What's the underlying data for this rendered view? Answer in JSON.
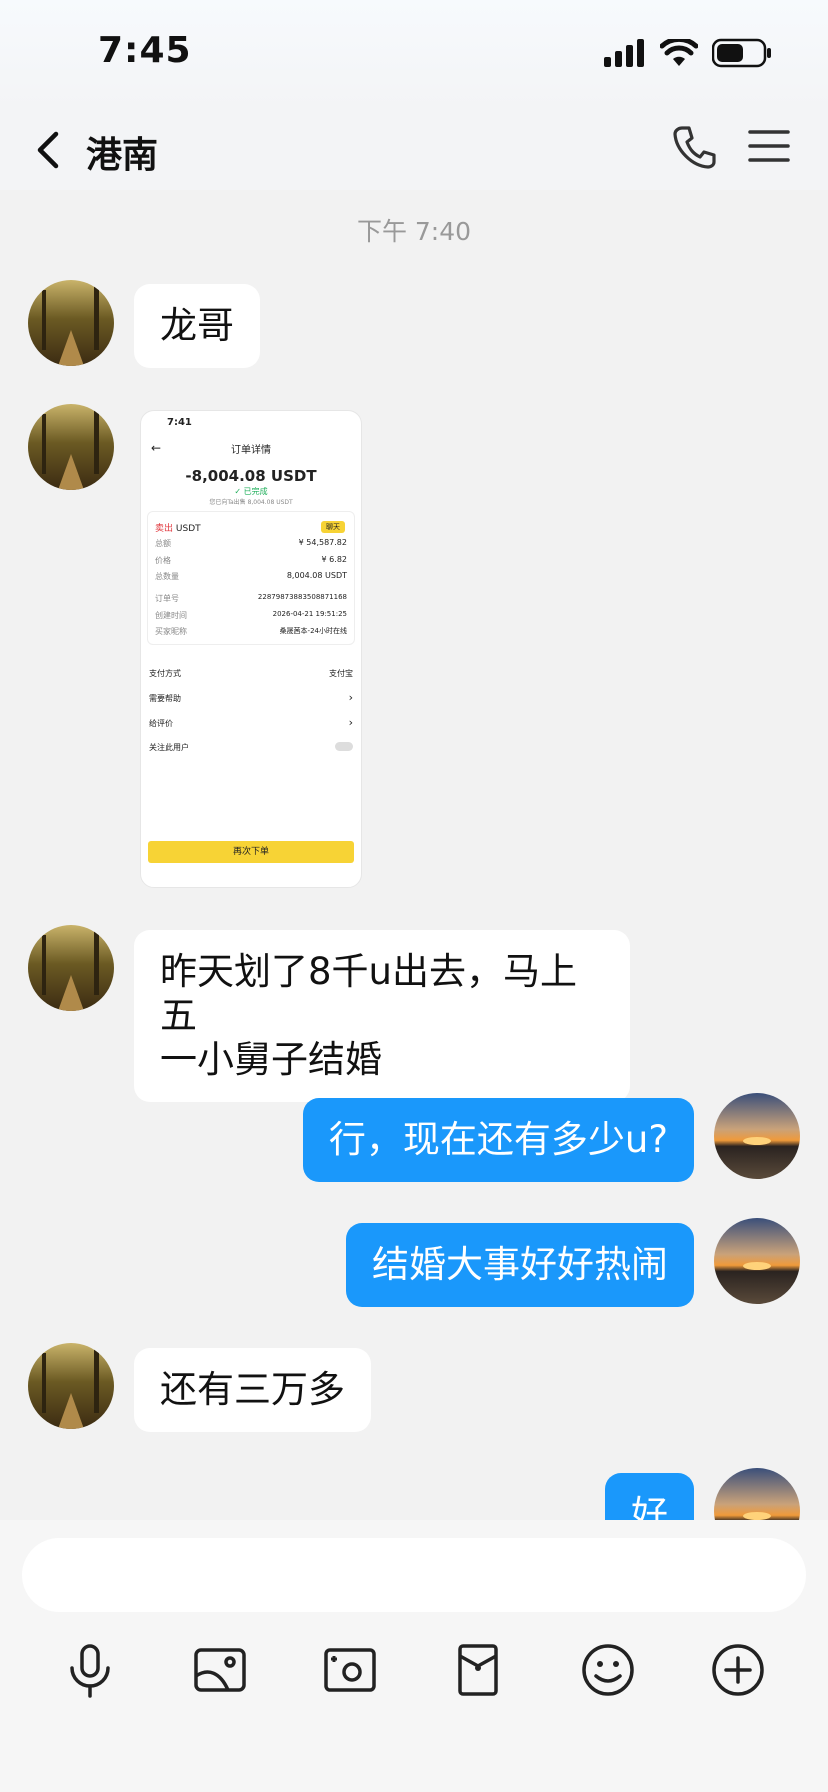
{
  "status": {
    "time": "7:45"
  },
  "nav": {
    "title": "港南"
  },
  "chat": {
    "time_divider": "下午 7:40",
    "messages": [
      {
        "side": "in",
        "text": "龙哥"
      },
      {
        "side": "in",
        "type": "image"
      },
      {
        "side": "in",
        "text_line1": "昨天划了8千u出去，马上五",
        "text_line2": "一小舅子结婚"
      },
      {
        "side": "out",
        "text": "行，现在还有多少u?"
      },
      {
        "side": "out",
        "text": "结婚大事好好热闹"
      },
      {
        "side": "in",
        "text": "还有三万多"
      },
      {
        "side": "out",
        "text": "好"
      }
    ]
  },
  "shared_screenshot": {
    "time": "7:41",
    "page_title": "订单详情",
    "amount": "-8,004.08 USDT",
    "status": "已完成",
    "sub_note": "您已向Ta出售 8,004.08 USDT",
    "sell_label": "卖出",
    "sell_asset": "USDT",
    "chat_tag": "聊天",
    "rows": [
      {
        "label": "总额",
        "value": "¥ 54,587.82"
      },
      {
        "label": "价格",
        "value": "¥ 6.82"
      },
      {
        "label": "总数量",
        "value": "8,004.08 USDT"
      }
    ],
    "order_rows": [
      {
        "label": "订单号",
        "value": "2287987388350887116​8"
      },
      {
        "label": "创建时间",
        "value": "2026-04-21 19:51:25"
      },
      {
        "label": "买家昵称",
        "value": "桑晟茜本-24小时在线"
      }
    ],
    "list_rows": [
      {
        "label": "支付方式",
        "value": "支付宝"
      },
      {
        "label": "需要帮助",
        "value": "›"
      },
      {
        "label": "给评价",
        "value": "›"
      },
      {
        "label": "关注此用户",
        "value": ""
      }
    ],
    "reorder_button": "再次下单"
  },
  "input": {
    "placeholder": ""
  },
  "toolbar": [
    "microphone-icon",
    "image-icon",
    "camera-icon",
    "red-packet-icon",
    "emoji-icon",
    "plus-icon"
  ],
  "colors": {
    "outgoing_bubble": "#1a98fb",
    "incoming_bubble": "#ffffff",
    "background": "#f2f2f2",
    "accent_yellow": "#f7d335"
  }
}
